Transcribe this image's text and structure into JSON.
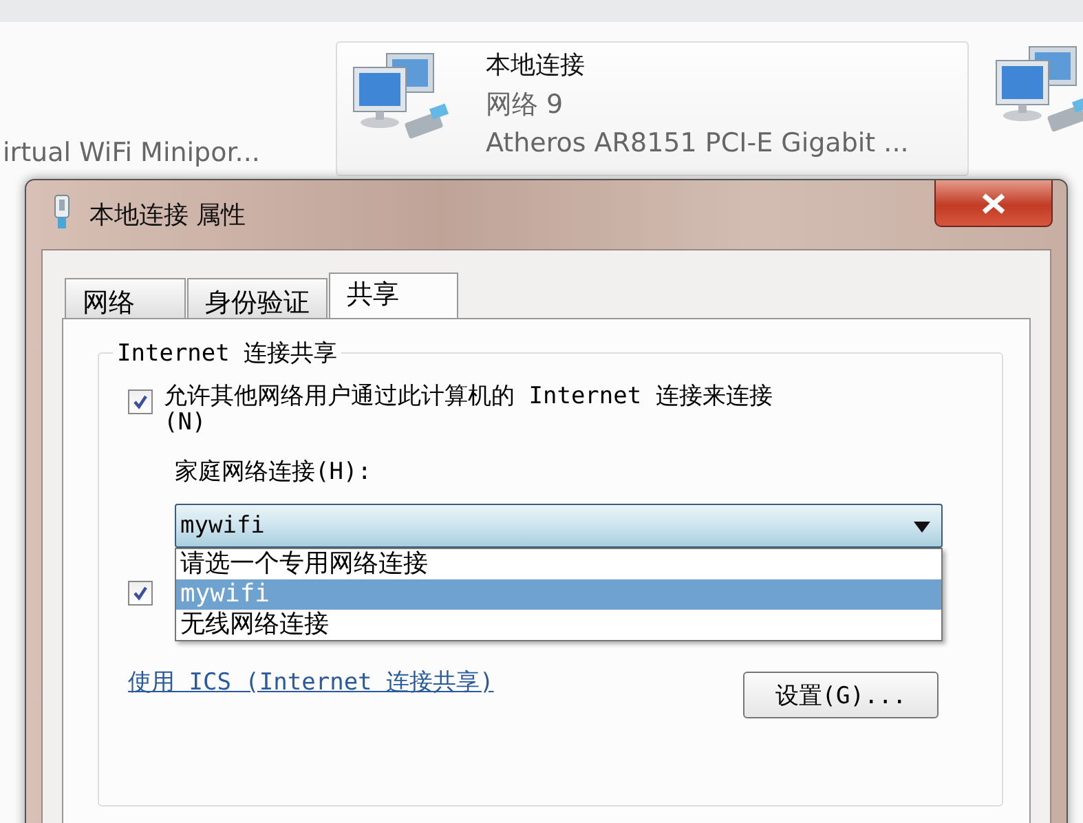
{
  "adapters": [
    {
      "kind": "partial",
      "description": "irtual WiFi Minipor..."
    },
    {
      "kind": "full",
      "name": "本地连接",
      "network": "网络 9",
      "description": "Atheros AR8151 PCI-E Gigabit ..."
    },
    {
      "kind": "icon-only"
    }
  ],
  "dialog": {
    "title": "本地连接 属性",
    "tabs": [
      {
        "label": "网络",
        "selected": false
      },
      {
        "label": "身份验证",
        "selected": false
      },
      {
        "label": "共享",
        "selected": true
      }
    ],
    "group": {
      "title": "Internet 连接共享",
      "allow_sharing": {
        "label": "允许其他网络用户通过此计算机的 Internet 连接来连接(N)",
        "checked": true
      },
      "home_label": "家庭网络连接(H):",
      "dropdown": {
        "value": "mywifi",
        "expanded": true,
        "options": [
          {
            "label": "请选一个专用网络连接",
            "selected": false
          },
          {
            "label": "mywifi",
            "selected": true
          },
          {
            "label": "无线网络连接",
            "selected": false
          }
        ]
      },
      "allow_control": {
        "checked": true
      },
      "link": "使用 ICS (Internet 连接共享)",
      "settings_button": "设置(G)..."
    }
  }
}
